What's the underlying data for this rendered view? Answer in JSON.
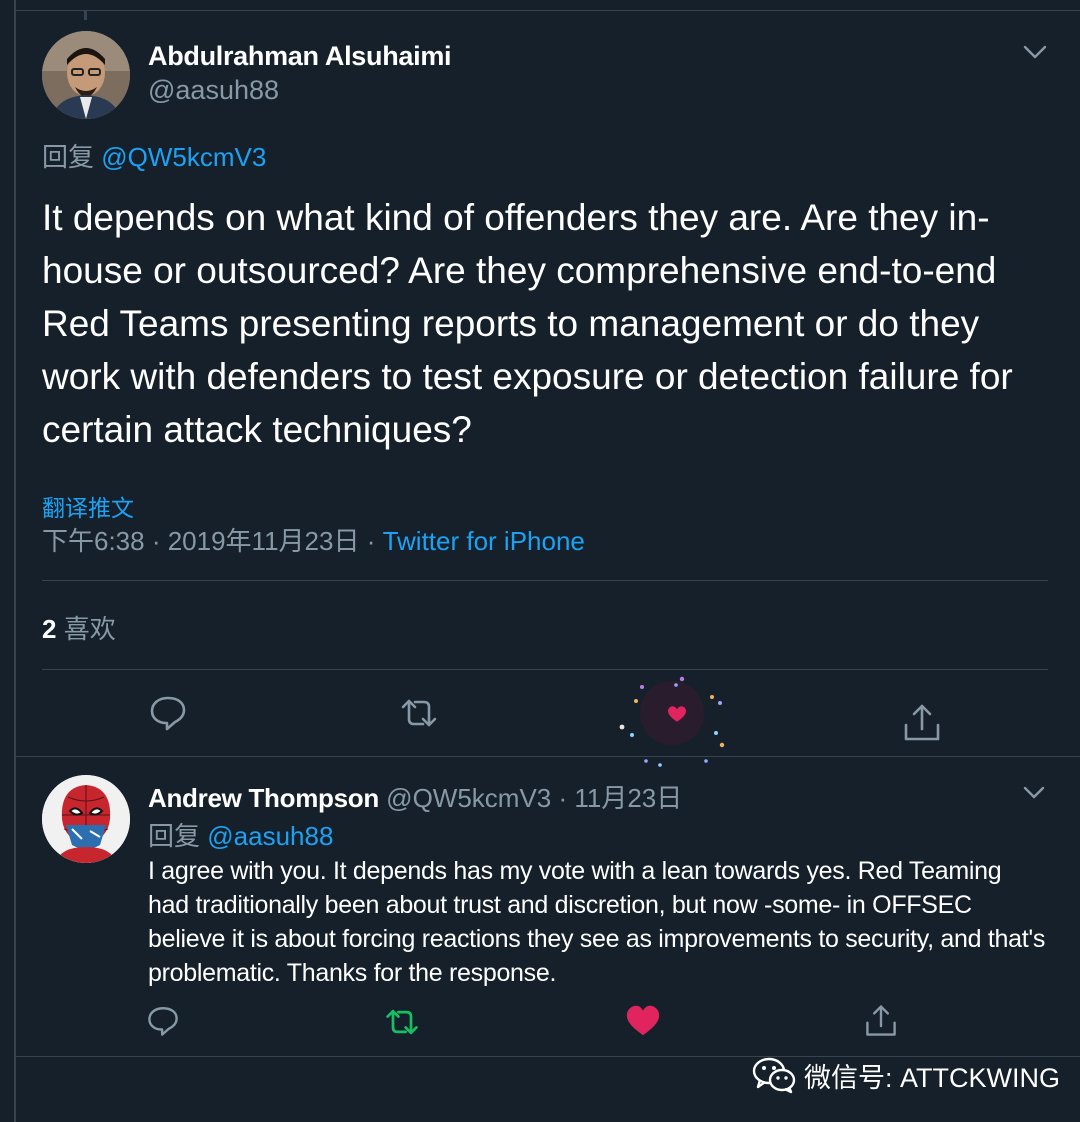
{
  "main_tweet": {
    "author_name": "Abdulrahman Alsuhaimi",
    "author_handle": "@aasuh88",
    "reply_prefix": "回复",
    "reply_to": "@QW5kcmV3",
    "text": "It depends on what kind of offenders they are. Are they in-house or outsourced? Are they comprehensive end-to-end Red Teams presenting reports to management or do they work with defenders to test exposure or detection failure for certain attack techniques?",
    "translate_label": "翻译推文",
    "time": "下午6:38 · 2019年11月23日",
    "separator": " · ",
    "source": "Twitter for iPhone",
    "likes_count": "2",
    "likes_label": "喜欢"
  },
  "reply_tweet": {
    "author_name": "Andrew Thompson",
    "author_handle": "@QW5kcmV3",
    "date": " · 11月23日",
    "reply_prefix": "回复",
    "reply_to": "@aasuh88",
    "text": "I agree with you. It depends has my vote with a lean towards yes. Red Teaming had traditionally been about trust and discretion, but now -some- in OFFSEC believe it is about forcing reactions they see as improvements to security, and that's problematic. Thanks for the response."
  },
  "watermark": {
    "text": "微信号: ATTCKWING",
    "icon": "wechat-icon"
  },
  "colors": {
    "background": "#15202b",
    "link": "#1da1f2",
    "muted": "#8899a6",
    "like": "#e0245e",
    "retweet": "#17bf63"
  },
  "icons": [
    "chevron-down-icon",
    "reply-icon",
    "retweet-icon",
    "like-icon",
    "share-icon",
    "wechat-icon"
  ]
}
